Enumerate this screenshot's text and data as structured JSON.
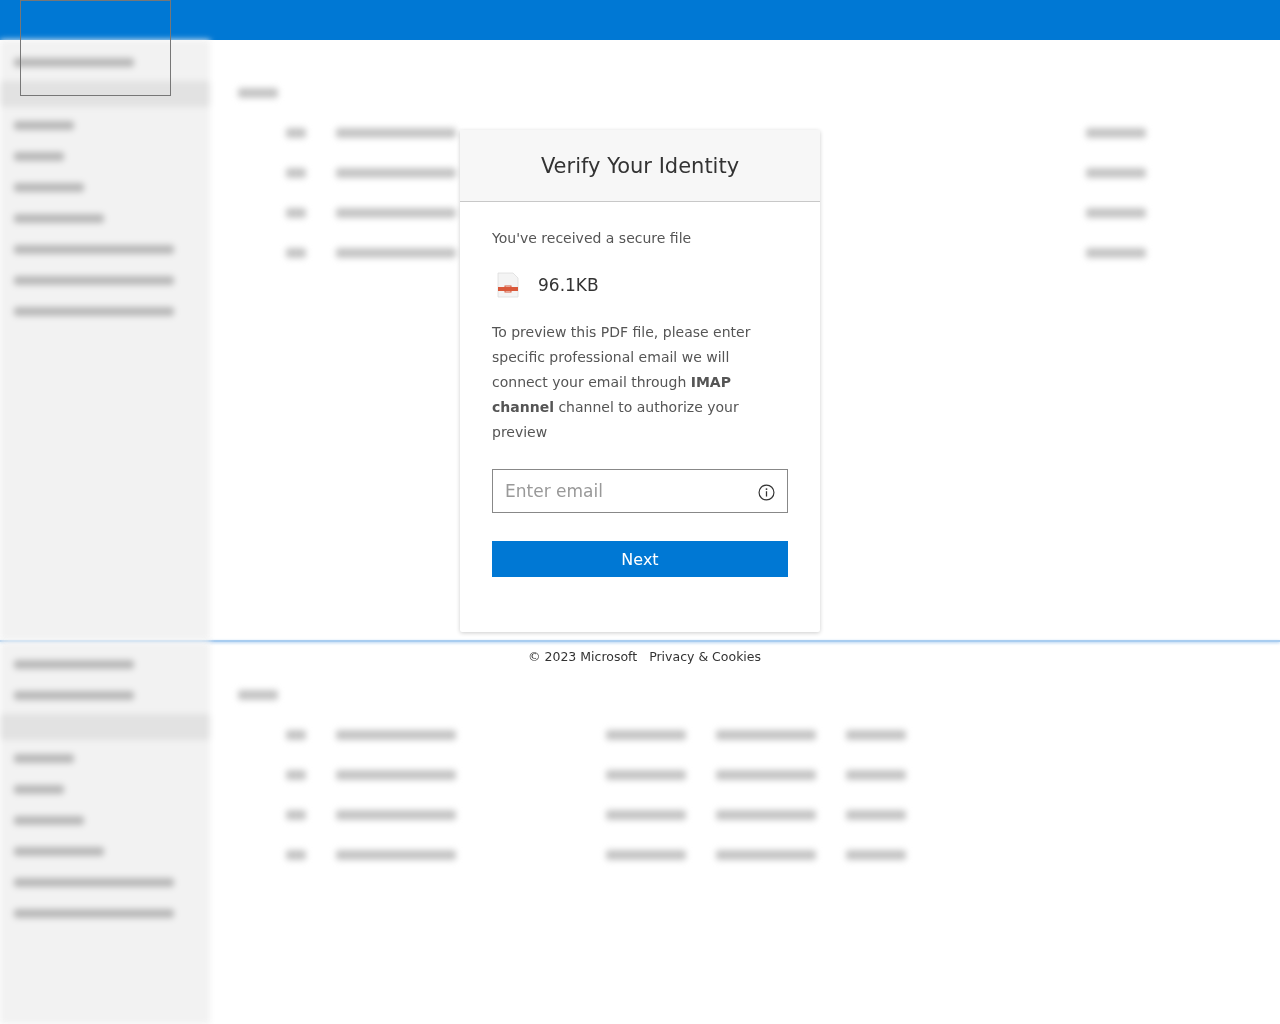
{
  "dialog": {
    "title": "Verify Your Identity",
    "intro": "You've received a secure file",
    "file": {
      "size": "96.1KB"
    },
    "message": "To preview this PDF file, please enter specific professional email we will connect your email through **IMAP channel** channel to authorize your preview",
    "email_field": {
      "placeholder": "Enter email"
    },
    "button": "Next"
  },
  "footer": {
    "copyright": "© 2023 Microsoft",
    "link": "Privacy & Cookies"
  }
}
